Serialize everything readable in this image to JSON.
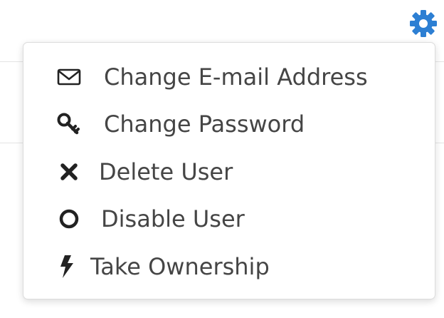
{
  "header": {
    "settings_icon": "gear-icon",
    "accent_color": "#2d7fd3"
  },
  "menu": {
    "items": [
      {
        "label": "Change E-mail Address",
        "icon": "envelope-icon"
      },
      {
        "label": "Change Password",
        "icon": "key-icon"
      },
      {
        "label": "Delete User",
        "icon": "times-icon"
      },
      {
        "label": "Disable User",
        "icon": "circle-icon"
      },
      {
        "label": "Take Ownership",
        "icon": "bolt-icon"
      }
    ],
    "text_color": "#454545",
    "icon_color": "#222222"
  }
}
